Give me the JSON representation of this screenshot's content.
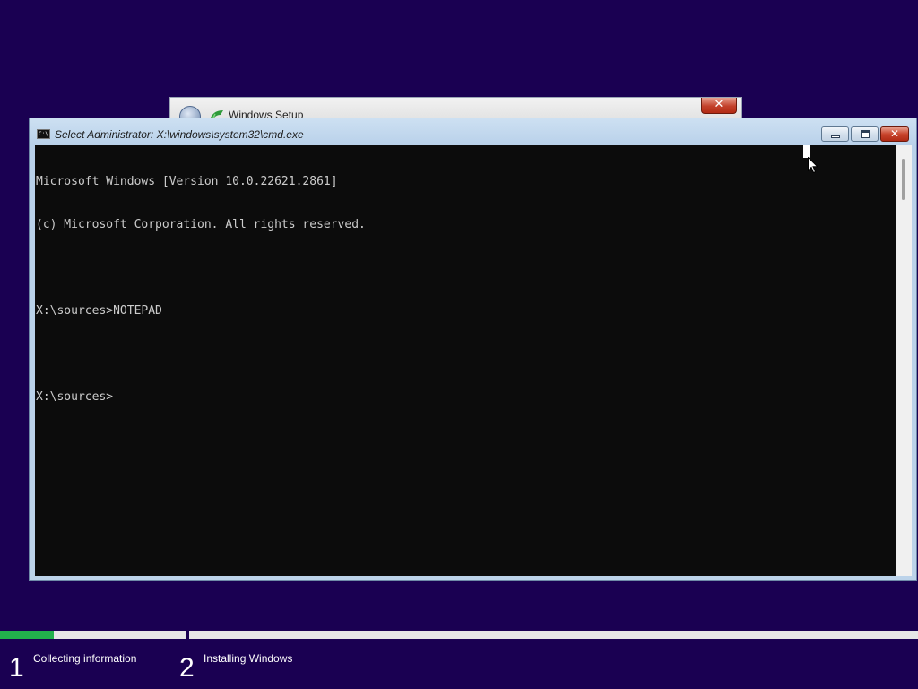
{
  "setup_window": {
    "title": "Windows Setup",
    "close_glyph": "✕",
    "back_icon": "back-arrow-icon",
    "app_icon": "windows-setup-icon"
  },
  "cmd_window": {
    "title": "Select Administrator: X:\\windows\\system32\\cmd.exe",
    "icon": "command-prompt-icon",
    "icon_text": "C:\\",
    "buttons": {
      "minimize": "minimize-icon",
      "maximize": "maximize-icon",
      "close": "✕"
    },
    "console_lines": [
      "Microsoft Windows [Version 10.0.22621.2861]",
      "(c) Microsoft Corporation. All rights reserved.",
      "",
      "X:\\sources>NOTEPAD",
      "",
      "X:\\sources>"
    ]
  },
  "setup_progress": {
    "step1_fill_fraction": 0.29,
    "steps": [
      {
        "number": "1",
        "label": "Collecting information"
      },
      {
        "number": "2",
        "label": "Installing Windows"
      }
    ]
  },
  "colors": {
    "desktop_bg": "#1a0052",
    "console_bg": "#0c0c0c",
    "console_text": "#cccccc",
    "progress_fill": "#22b14c"
  }
}
